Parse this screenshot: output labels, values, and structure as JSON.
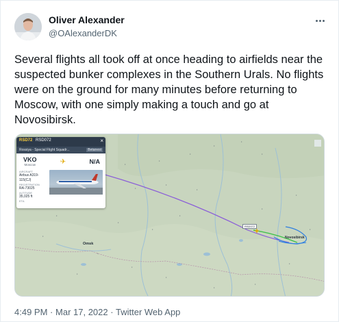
{
  "author": {
    "name": "Oliver Alexander",
    "handle": "@OAlexanderDK"
  },
  "menu": {
    "more_icon": "ellipsis-icon"
  },
  "tweet": {
    "text": "Several flights all took off at once heading to airfields near the suspected bunker complexes in the Southern Urals. No flights were on the ground for many minutes before returning to Moscow, with one simply making a touch and go at Novosibirsk."
  },
  "media": {
    "flight_card": {
      "flight_id": "RSD72",
      "header_extra": "RSD072",
      "operator": "Rossiya - Special Flight Squadr...",
      "badge": "Betanest",
      "origin_code": "VKO",
      "origin_city": "Moscow",
      "dest_code": "N/A",
      "aircraft_label": "AIRCRAFT",
      "aircraft_value": "Airbus A319-115(CJ)",
      "registration_label": "REGISTRATION",
      "registration_value": "RA-73025",
      "altitude_label": "ALTITUDE",
      "altitude_value": "35,025 ft",
      "eta_label": "ETA"
    },
    "map_labels": {
      "omsk": "Omsk",
      "novosibirsk": "Novosibirsk",
      "callsign_tag": "RSD072"
    },
    "colors": {
      "map_land": "#c9d6bf",
      "track_purple": "#8a5cd8",
      "track_green": "#3ec24a",
      "track_blue": "#2f7fe0"
    }
  },
  "footer": {
    "time": "4:49 PM",
    "separator1": "·",
    "date": "Mar 17, 2022",
    "separator2": "·",
    "source": "Twitter Web App"
  }
}
